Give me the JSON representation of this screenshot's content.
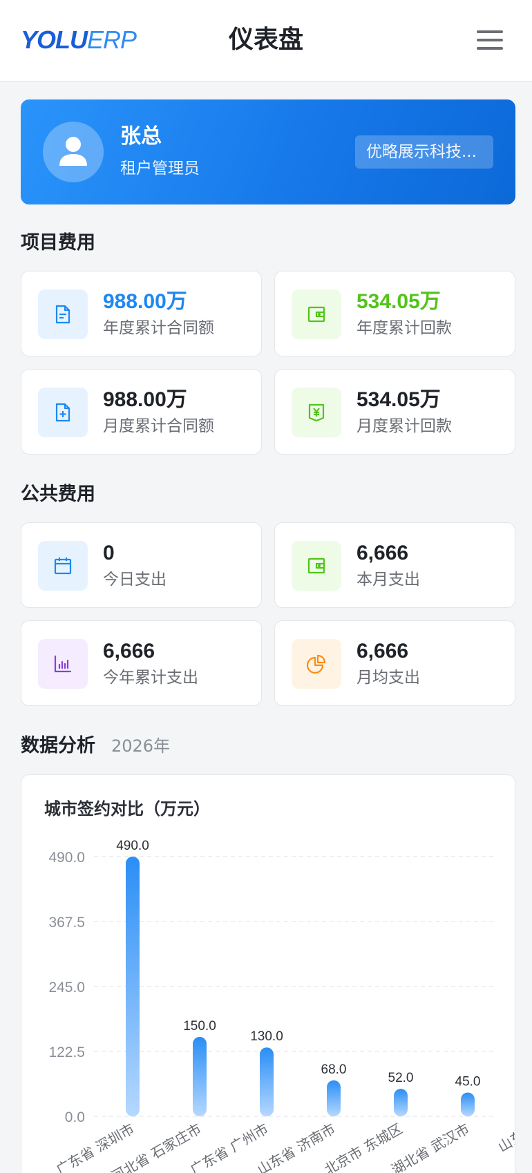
{
  "header": {
    "logo_part1": "YOLU",
    "logo_part2": "ERP",
    "title": "仪表盘"
  },
  "user": {
    "name": "张总",
    "role": "租户管理员",
    "company": "优略展示科技..."
  },
  "project_costs": {
    "title": "项目费用",
    "cards": [
      {
        "value": "988.00万",
        "label": "年度累计合同额",
        "icon": "document-icon",
        "color": "#1e88f0"
      },
      {
        "value": "534.05万",
        "label": "年度累计回款",
        "icon": "wallet-icon",
        "color": "#52c41a"
      },
      {
        "value": "988.00万",
        "label": "月度累计合同额",
        "icon": "document-add-icon",
        "color": "#1f2329"
      },
      {
        "value": "534.05万",
        "label": "月度累计回款",
        "icon": "yen-wallet-icon",
        "color": "#1f2329"
      }
    ]
  },
  "public_costs": {
    "title": "公共费用",
    "cards": [
      {
        "value": "0",
        "label": "今日支出",
        "icon": "calendar-icon"
      },
      {
        "value": "6,666",
        "label": "本月支出",
        "icon": "wallet-icon"
      },
      {
        "value": "6,666",
        "label": "今年累计支出",
        "icon": "bar-chart-icon"
      },
      {
        "value": "6,666",
        "label": "月均支出",
        "icon": "pie-chart-icon"
      }
    ]
  },
  "analysis": {
    "title": "数据分析",
    "year": "2026年"
  },
  "chart_data": {
    "type": "bar",
    "title": "城市签约对比（万元）",
    "categories": [
      "广东省 深圳市",
      "河北省 石家庄市",
      "广东省 广州市",
      "山东省 济南市",
      "北京市 东城区",
      "湖北省 武汉市",
      "山东省"
    ],
    "values": [
      490.0,
      150.0,
      130.0,
      68.0,
      52.0,
      45.0,
      null
    ],
    "value_labels": [
      "490.0",
      "150.0",
      "130.0",
      "68.0",
      "52.0",
      "45.0"
    ],
    "y_ticks": [
      "0.0",
      "122.5",
      "245.0",
      "367.5",
      "490.0"
    ],
    "ylim": [
      0,
      490
    ],
    "grid": true,
    "bar_color_top": "#2a8ef5",
    "bar_color_bottom": "#b5d8ff"
  }
}
